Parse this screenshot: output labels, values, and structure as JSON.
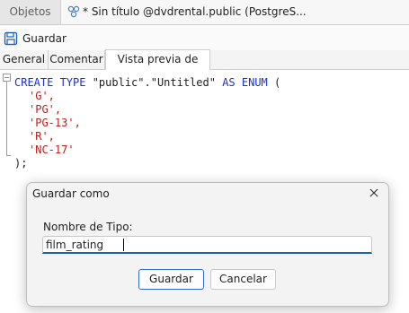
{
  "tabs": {
    "objects_label": "Objetos",
    "active_label": "* Sin título @dvdrental.public (PostgreS..."
  },
  "toolbar": {
    "save_label": "Guardar"
  },
  "sub_tabs": [
    "General",
    "Comentar",
    "Vista previa de SQL"
  ],
  "sql": {
    "line1_kw1": "CREATE TYPE",
    "line1_mid": " \"public\".\"Untitled\" ",
    "line1_kw2": "AS ENUM",
    "line1_end": " (",
    "values": [
      "'G',",
      "'PG',",
      "'PG-13',",
      "'R',",
      "'NC-17'"
    ],
    "closing": ");"
  },
  "dialog": {
    "title": "Guardar como",
    "field_label": "Nombre de Tipo:",
    "field_value": "film_rating",
    "ok_label": "Guardar",
    "cancel_label": "Cancelar"
  },
  "colors": {
    "keyword": "#1a2fd6",
    "string": "#c41a16",
    "accent": "#1a5fb4"
  }
}
